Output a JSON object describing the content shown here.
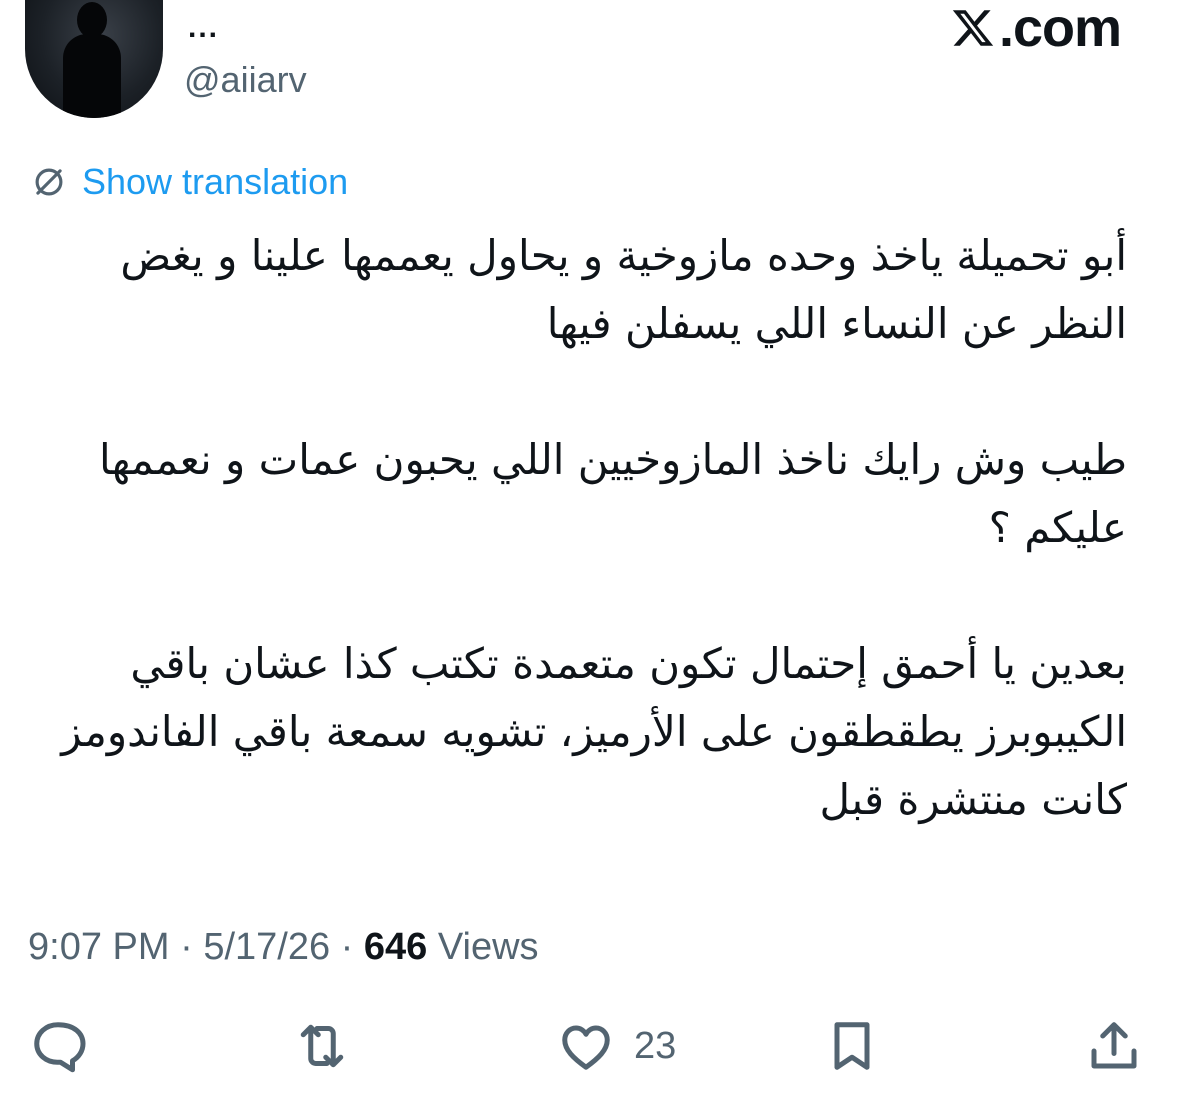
{
  "author": {
    "display_name": "...",
    "handle": "@aiiarv"
  },
  "brand": {
    "label": ".com"
  },
  "translation": {
    "label": "Show translation"
  },
  "tweet": {
    "paragraphs": [
      "أبو تحميلة ياخذ وحده مازوخية و يحاول يعممها علينا و يغض النظر عن النساء اللي يسفلن فيها",
      "طيب وش رايك ناخذ المازوخيين اللي يحبون عمات و نعممها عليكم ؟",
      "بعدين يا أحمق إحتمال تكون متعمدة تكتب كذا عشان باقي الكيبوبرز يطقطقون على الأرميز، تشويه سمعة باقي الفاندومز كانت منتشرة قبل"
    ]
  },
  "meta": {
    "time": "9:07 PM",
    "separator": "·",
    "date": "5/17/26",
    "views_count": "646",
    "views_label": "Views"
  },
  "actions": {
    "reply_icon": "reply-icon",
    "retweet_icon": "retweet-icon",
    "like_icon": "heart-icon",
    "like_count": "23",
    "bookmark_icon": "bookmark-icon",
    "share_icon": "share-icon"
  },
  "colors": {
    "link": "#1d9bf0",
    "secondary_text": "#536471",
    "primary_text": "#0f1419"
  }
}
